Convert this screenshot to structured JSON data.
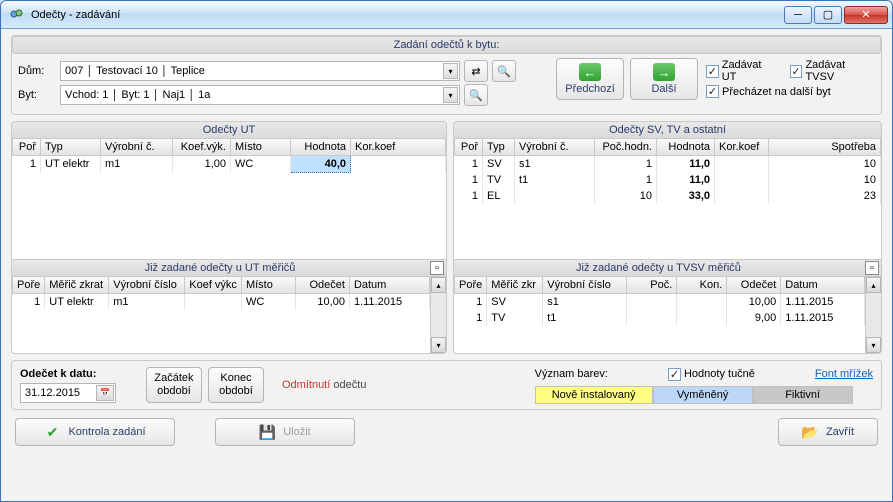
{
  "window": {
    "title": "Odečty - zadávání"
  },
  "header": {
    "group_title": "Zadání odečtů k bytu:",
    "dum_label": "Dům:",
    "dum_value": "007 │ Testovací 10 │ Teplice",
    "byt_label": "Byt:",
    "byt_value": "Vchod: 1 │ Byt: 1 │ Naj1 │ 1a",
    "prev_label": "Předchozí",
    "next_label": "Další",
    "chk_ut": "Zadávat UT",
    "chk_tvsv": "Zadávat TVSV",
    "chk_next": "Přecházet na další byt"
  },
  "left": {
    "title": "Odečty UT",
    "cols": [
      "Poř",
      "Typ",
      "Výrobní č.",
      "Koef.výk.",
      "Místo",
      "Hodnota",
      "Kor.koef"
    ],
    "rows": [
      {
        "por": "1",
        "typ": "UT elektr",
        "vyr": "m1",
        "koef": "1,00",
        "misto": "WC",
        "hodnota": "40,0",
        "korkoef": ""
      }
    ],
    "sub_title": "Již zadané odečty u UT měřičů",
    "sub_cols": [
      "Poře",
      "Měřič zkrat",
      "Výrobní číslo",
      "Koef výkc",
      "Místo",
      "Odečet",
      "Datum"
    ],
    "sub_rows": [
      {
        "por": "1",
        "mz": "UT elektr",
        "vyr": "m1",
        "koef": "",
        "misto": "WC",
        "odecet": "10,00",
        "datum": "1.11.2015"
      }
    ]
  },
  "right": {
    "title": "Odečty SV, TV a ostatní",
    "cols": [
      "Poř",
      "Typ",
      "Výrobní č.",
      "Poč.hodn.",
      "Hodnota",
      "Kor.koef",
      "Spotřeba"
    ],
    "rows": [
      {
        "por": "1",
        "typ": "SV",
        "vyr": "s1",
        "poc": "1",
        "hod": "11,0",
        "kor": "",
        "spot": "10"
      },
      {
        "por": "1",
        "typ": "TV",
        "vyr": "t1",
        "poc": "1",
        "hod": "11,0",
        "kor": "",
        "spot": "10"
      },
      {
        "por": "1",
        "typ": "EL",
        "vyr": "",
        "poc": "10",
        "hod": "33,0",
        "kor": "",
        "spot": "23"
      }
    ],
    "sub_title": "Již zadané odečty u TVSV měřičů",
    "sub_cols": [
      "Poře",
      "Měřič zkr",
      "Výrobní číslo",
      "Poč.",
      "Kon.",
      "Odečet",
      "Datum"
    ],
    "sub_rows": [
      {
        "por": "1",
        "mz": "SV",
        "vyr": "s1",
        "poc": "",
        "kon": "",
        "odecet": "10,00",
        "datum": "1.11.2015"
      },
      {
        "por": "1",
        "mz": "TV",
        "vyr": "t1",
        "poc": "",
        "kon": "",
        "odecet": "9,00",
        "datum": "1.11.2015"
      }
    ]
  },
  "options": {
    "date_label": "Odečet k datu:",
    "date_value": "31.12.2015",
    "start_period": "Začátek období",
    "end_period": "Konec období",
    "reject": "Odmítnutí",
    "reject_suffix": " odečtu",
    "legend_label": "Význam barev:",
    "chk_bold": "Hodnoty tučně",
    "font_link": "Font mřížek",
    "chip_new": "Nově instalovaný",
    "chip_swapped": "Vyměněný",
    "chip_fictive": "Fiktivní"
  },
  "footer": {
    "check": "Kontrola zadání",
    "save": "Uložit",
    "close": "Zavřít"
  }
}
